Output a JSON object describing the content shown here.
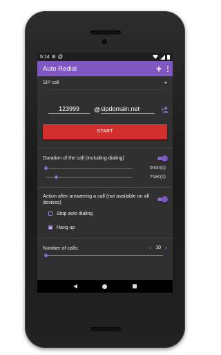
{
  "status_bar": {
    "time": "5:14",
    "icons": [
      "settings-icon",
      "at-sign-icon",
      "wifi-icon",
      "signal-icon",
      "battery-icon"
    ]
  },
  "app_bar": {
    "title": "Auto Redial",
    "add_icon": "plus-icon",
    "menu_icon": "overflow-menu-icon",
    "background": "#7e57c2"
  },
  "call_type": {
    "selected": "SIP call"
  },
  "sip": {
    "number": "123999",
    "at": "@",
    "domain": "sipdomain.net",
    "contacts_icon": "add-contact-icon"
  },
  "start_button": {
    "label": "START",
    "color": "#d32f2f"
  },
  "duration": {
    "label": "Duration of the call (including dialing)",
    "enabled": true,
    "minutes": "0min(s)",
    "seconds": "7sec(s)",
    "minutes_fraction": 0.0,
    "seconds_fraction": 0.1
  },
  "after_answer": {
    "label": "Action after answering a call (not available on all devices)",
    "enabled": true,
    "options": [
      {
        "label": "Stop auto dialing",
        "checked": false
      },
      {
        "label": "Hang up",
        "checked": true
      }
    ]
  },
  "calls": {
    "label": "Number of calls:",
    "value": "10"
  },
  "nav_bar": {
    "icons": [
      "back-icon",
      "home-icon",
      "recent-apps-icon"
    ]
  }
}
